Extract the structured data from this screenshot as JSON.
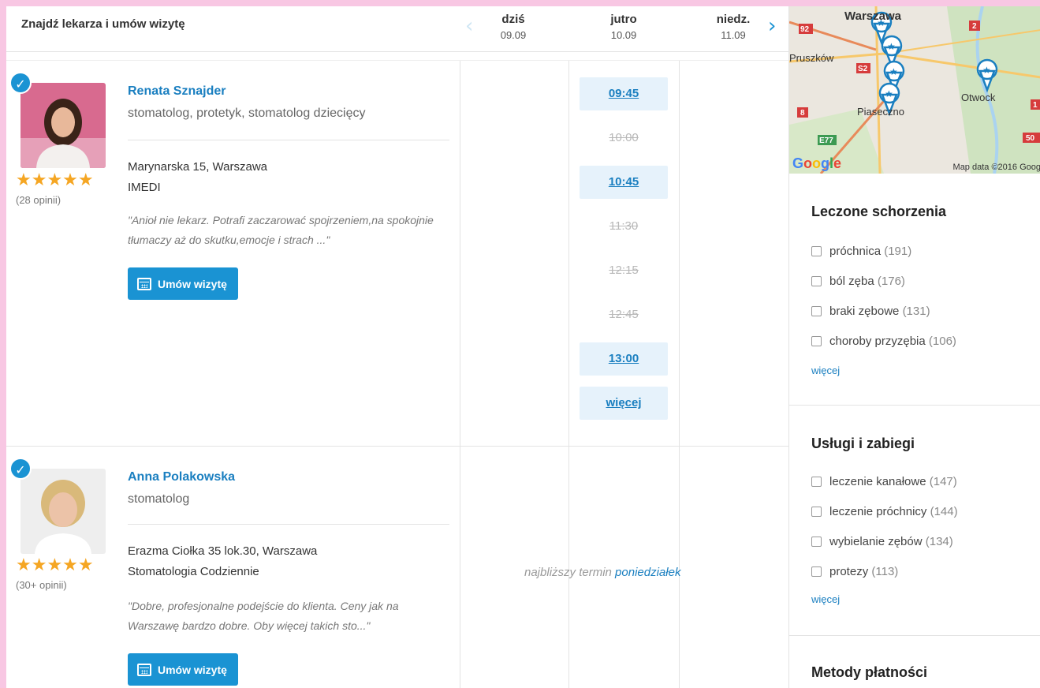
{
  "header": {
    "title": "Znajdź lekarza i umów wizytę",
    "days": [
      {
        "name": "dziś",
        "date": "09.09"
      },
      {
        "name": "jutro",
        "date": "10.09"
      },
      {
        "name": "niedz.",
        "date": "11.09"
      }
    ],
    "prev_icon": "chevron-left-icon",
    "next_icon": "chevron-right-icon"
  },
  "doctors": [
    {
      "name": "Renata Sznajder",
      "specialty": "stomatolog, protetyk, stomatolog dziecięcy",
      "address": "Marynarska 15, Warszawa",
      "clinic": "IMEDI",
      "quote": "\"Anioł nie lekarz. Potrafi zaczarować spojrzeniem,na spokojnie tłumaczy aż do skutku,emocje i strach ...\"",
      "rating": "★★★★★",
      "reviews": "(28 opinii)",
      "book_label": "Umów wizytę",
      "verified_icon": "checkmark-icon",
      "slots": [
        {
          "time": "09:45",
          "free": true
        },
        {
          "time": "10:00",
          "free": false
        },
        {
          "time": "10:45",
          "free": true
        },
        {
          "time": "11:30",
          "free": false
        },
        {
          "time": "12:15",
          "free": false
        },
        {
          "time": "12:45",
          "free": false
        },
        {
          "time": "13:00",
          "free": true
        }
      ],
      "more_slots": "więcej"
    },
    {
      "name": "Anna Polakowska",
      "specialty": "stomatolog",
      "address": "Erazma Ciołka 35 lok.30, Warszawa",
      "clinic": "Stomatologia Codziennie",
      "quote": "\"Dobre, profesjonalne podejście do klienta. Ceny jak na Warszawę bardzo dobre. Oby więcej takich sto...\"",
      "rating": "★★★★★",
      "reviews": "(30+ opinii)",
      "book_label": "Umów wizytę",
      "verified_icon": "checkmark-icon",
      "next_term_prefix": "najbliższy termin ",
      "next_term_link": "poniedziałek"
    }
  ],
  "map": {
    "labels": [
      "Warszawa",
      "Pruszków",
      "Piaseczno",
      "Otwock"
    ],
    "road_badges": [
      "92",
      "S2",
      "8",
      "E77",
      "2",
      "50",
      "1"
    ],
    "google": "Google",
    "copyright": "Map data ©2016 Goog"
  },
  "filters": [
    {
      "title": "Leczone schorzenia",
      "items": [
        {
          "label": "próchnica",
          "count": "(191)"
        },
        {
          "label": "ból zęba",
          "count": "(176)"
        },
        {
          "label": "braki zębowe",
          "count": "(131)"
        },
        {
          "label": "choroby przyzębia",
          "count": "(106)"
        }
      ],
      "more": "więcej"
    },
    {
      "title": "Usługi i zabiegi",
      "items": [
        {
          "label": "leczenie kanałowe",
          "count": "(147)"
        },
        {
          "label": "leczenie próchnicy",
          "count": "(144)"
        },
        {
          "label": "wybielanie zębów",
          "count": "(134)"
        },
        {
          "label": "protezy",
          "count": "(113)"
        }
      ],
      "more": "więcej"
    },
    {
      "title": "Metody płatności"
    }
  ],
  "colors": {
    "accent": "#1a93d3",
    "link": "#1a7fc0",
    "star": "#f5a623",
    "slot_bg": "#e6f2fb",
    "frame": "#f8c7e3"
  }
}
